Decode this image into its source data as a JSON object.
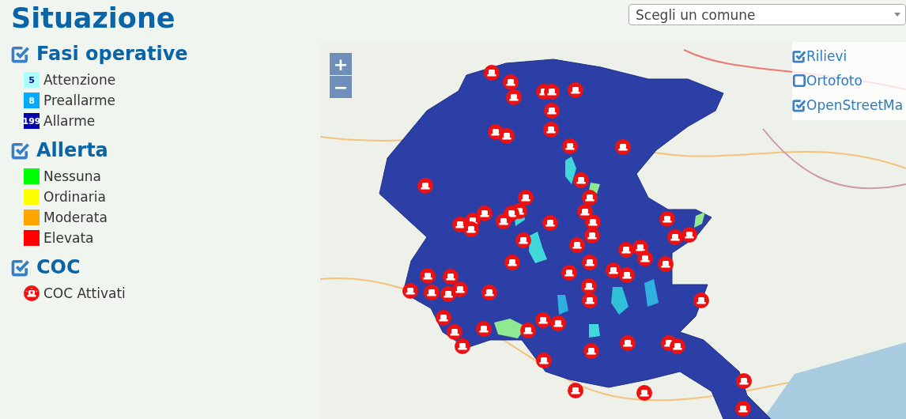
{
  "title": "Situazione",
  "comune_select": {
    "placeholder": "Scegli un comune"
  },
  "legend": [
    {
      "heading": "Fasi operative",
      "checked": true,
      "kind": "count",
      "items": [
        {
          "label": "Attenzione",
          "count": "5",
          "color": "#aaffff"
        },
        {
          "label": "Preallarme",
          "count": "8",
          "color": "#00aaff"
        },
        {
          "label": "Allarme",
          "count": "199",
          "color": "#0000aa"
        }
      ]
    },
    {
      "heading": "Allerta",
      "checked": true,
      "kind": "swatch",
      "items": [
        {
          "label": "Nessuna",
          "color": "#00ff00"
        },
        {
          "label": "Ordinaria",
          "color": "#ffff00"
        },
        {
          "label": "Moderata",
          "color": "#ffa500"
        },
        {
          "label": "Elevata",
          "color": "#ff0000"
        }
      ]
    },
    {
      "heading": "COC",
      "checked": true,
      "kind": "marker",
      "items": [
        {
          "label": "COC Attivati"
        }
      ]
    }
  ],
  "map": {
    "zoom_in": "+",
    "zoom_out": "−",
    "layers": [
      {
        "label": "Rilievi",
        "checked": true
      },
      {
        "label": "Ortofoto",
        "checked": false
      },
      {
        "label": "OpenStreetMa",
        "checked": true
      }
    ]
  }
}
